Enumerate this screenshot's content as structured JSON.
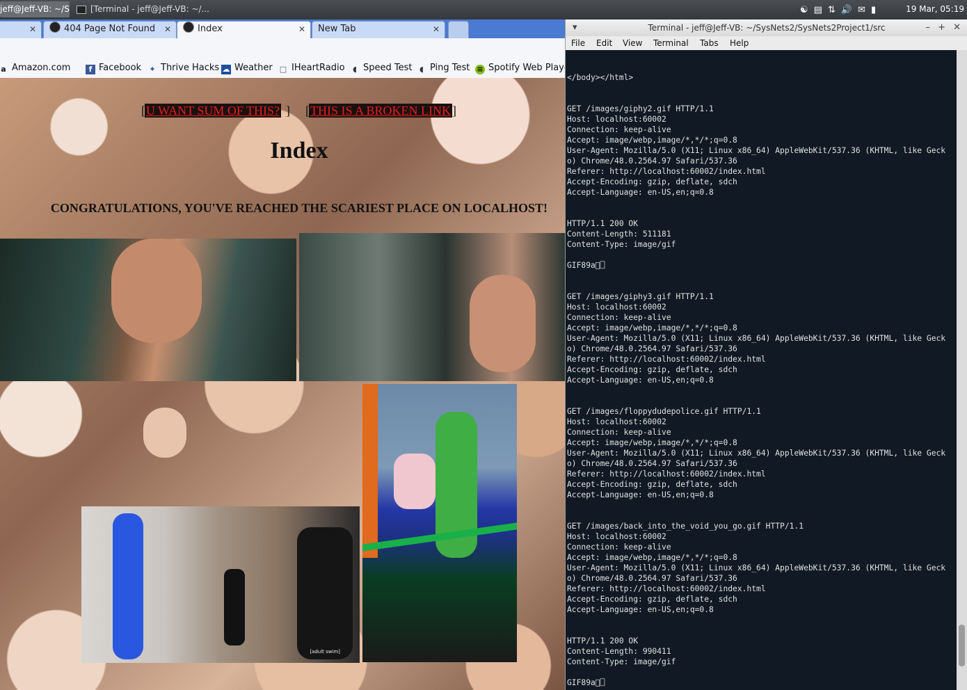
{
  "taskbar": {
    "task1": "jeff@Jeff-VB: ~/S...",
    "task2": "[Terminal - jeff@Jeff-VB: ~/...",
    "clock": "19 Mar, 05:19"
  },
  "browser": {
    "tabs": [
      {
        "title": "404 Page Not Found"
      },
      {
        "title": "Index"
      },
      {
        "title": "New Tab"
      }
    ],
    "bookmarks": [
      {
        "label": "Amazon.com",
        "icon": "amazon-icon"
      },
      {
        "label": "Facebook",
        "icon": "facebook-icon"
      },
      {
        "label": "Thrive Hacks",
        "icon": "thrive-icon"
      },
      {
        "label": "Weather",
        "icon": "weather-icon"
      },
      {
        "label": "IHeartRadio",
        "icon": "page-icon"
      },
      {
        "label": "Speed Test",
        "icon": "gauge-icon"
      },
      {
        "label": "Ping Test",
        "icon": "gauge-icon"
      },
      {
        "label": "Spotify Web Player",
        "icon": "spotify-icon"
      }
    ],
    "page": {
      "links": [
        "U WANT SUM OF THIS?",
        "THIS IS A BROKEN LINK"
      ],
      "title": "Index",
      "congrats": "CONGRATULATIONS, YOU'VE REACHED THE SCARIEST PLACE ON LOCALHOST!",
      "gif_caption": "[adult swim]"
    }
  },
  "terminal": {
    "title": "Terminal - jeff@Jeff-VB: ~/SysNets2/SysNets2Project1/src",
    "menu": [
      "File",
      "Edit",
      "View",
      "Terminal",
      "Tabs",
      "Help"
    ],
    "lines": [
      "",
      "",
      "</body></html>",
      "",
      "",
      "GET /images/giphy2.gif HTTP/1.1",
      "Host: localhost:60002",
      "Connection: keep-alive",
      "Accept: image/webp,image/*,*/*;q=0.8",
      "User-Agent: Mozilla/5.0 (X11; Linux x86_64) AppleWebKit/537.36 (KHTML, like Geck",
      "o) Chrome/48.0.2564.97 Safari/537.36",
      "Referer: http://localhost:60002/index.html",
      "Accept-Encoding: gzip, deflate, sdch",
      "Accept-Language: en-US,en;q=0.8",
      "",
      "",
      "HTTP/1.1 200 OK",
      "Content-Length: 511181",
      "Content-Type: image/gif",
      "",
      "GIF89a\u0000⎕",
      "",
      "",
      "GET /images/giphy3.gif HTTP/1.1",
      "Host: localhost:60002",
      "Connection: keep-alive",
      "Accept: image/webp,image/*,*/*;q=0.8",
      "User-Agent: Mozilla/5.0 (X11; Linux x86_64) AppleWebKit/537.36 (KHTML, like Geck",
      "o) Chrome/48.0.2564.97 Safari/537.36",
      "Referer: http://localhost:60002/index.html",
      "Accept-Encoding: gzip, deflate, sdch",
      "Accept-Language: en-US,en;q=0.8",
      "",
      "",
      "GET /images/floppydudepolice.gif HTTP/1.1",
      "Host: localhost:60002",
      "Connection: keep-alive",
      "Accept: image/webp,image/*,*/*;q=0.8",
      "User-Agent: Mozilla/5.0 (X11; Linux x86_64) AppleWebKit/537.36 (KHTML, like Geck",
      "o) Chrome/48.0.2564.97 Safari/537.36",
      "Referer: http://localhost:60002/index.html",
      "Accept-Encoding: gzip, deflate, sdch",
      "Accept-Language: en-US,en;q=0.8",
      "",
      "",
      "GET /images/back_into_the_void_you_go.gif HTTP/1.1",
      "Host: localhost:60002",
      "Connection: keep-alive",
      "Accept: image/webp,image/*,*/*;q=0.8",
      "User-Agent: Mozilla/5.0 (X11; Linux x86_64) AppleWebKit/537.36 (KHTML, like Geck",
      "o) Chrome/48.0.2564.97 Safari/537.36",
      "Referer: http://localhost:60002/index.html",
      "Accept-Encoding: gzip, deflate, sdch",
      "Accept-Language: en-US,en;q=0.8",
      "",
      "",
      "HTTP/1.1 200 OK",
      "Content-Length: 990411",
      "Content-Type: image/gif",
      "",
      "GIF89a\u0000⎕"
    ]
  }
}
